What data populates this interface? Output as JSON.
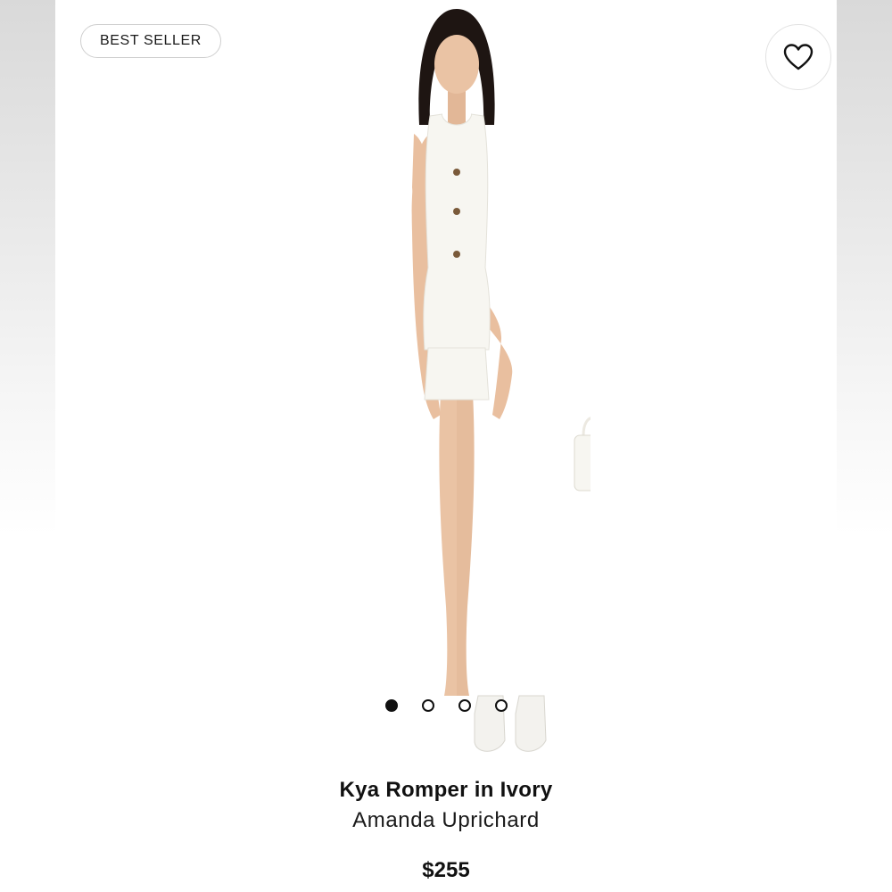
{
  "badge": {
    "label": "BEST SELLER"
  },
  "favorite": {
    "icon": "heart-icon"
  },
  "carousel": {
    "count": 4,
    "active_index": 0
  },
  "product": {
    "name": "Kya Romper in Ivory",
    "brand": "Amanda Uprichard",
    "price": "$255"
  },
  "colors": {
    "garment": "#f7f6f1",
    "skin": "#eac3a4",
    "hair": "#1e1512",
    "dot_active": "#111111"
  }
}
